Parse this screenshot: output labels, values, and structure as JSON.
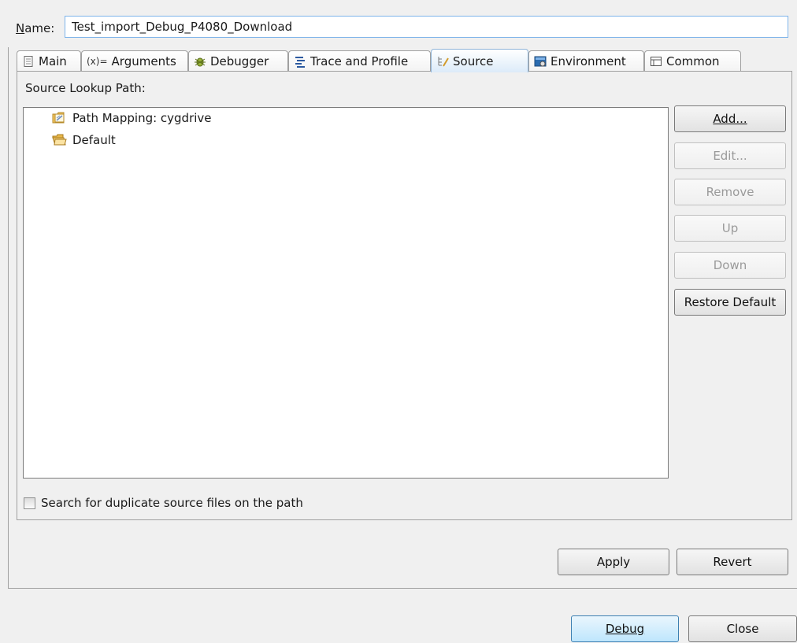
{
  "name_label": "Name:",
  "name_value": "Test_import_Debug_P4080_Download",
  "tabs": [
    {
      "label": "Main",
      "icon": "main-tab-icon"
    },
    {
      "label": "Arguments",
      "icon": "arguments-icon",
      "prefix": "(x)="
    },
    {
      "label": "Debugger",
      "icon": "debugger-bug-icon"
    },
    {
      "label": "Trace and Profile",
      "icon": "trace-profile-icon"
    },
    {
      "label": "Source",
      "icon": "source-icon",
      "active": true
    },
    {
      "label": "Environment",
      "icon": "environment-icon"
    },
    {
      "label": "Common",
      "icon": "common-icon"
    }
  ],
  "source_lookup_label": "Source Lookup Path:",
  "tree_items": [
    {
      "label": "Path Mapping: cygdrive",
      "icon": "path-mapping-icon"
    },
    {
      "label": "Default",
      "icon": "folder-open-icon"
    }
  ],
  "side_buttons": {
    "add": "Add...",
    "edit": "Edit...",
    "remove": "Remove",
    "up": "Up",
    "down": "Down",
    "restore": "Restore Default"
  },
  "dup_checkbox_label": "Search for duplicate source files on the path",
  "dup_checkbox_checked": false,
  "apply": "Apply",
  "revert": "Revert",
  "debug": "Debug",
  "close": "Close"
}
